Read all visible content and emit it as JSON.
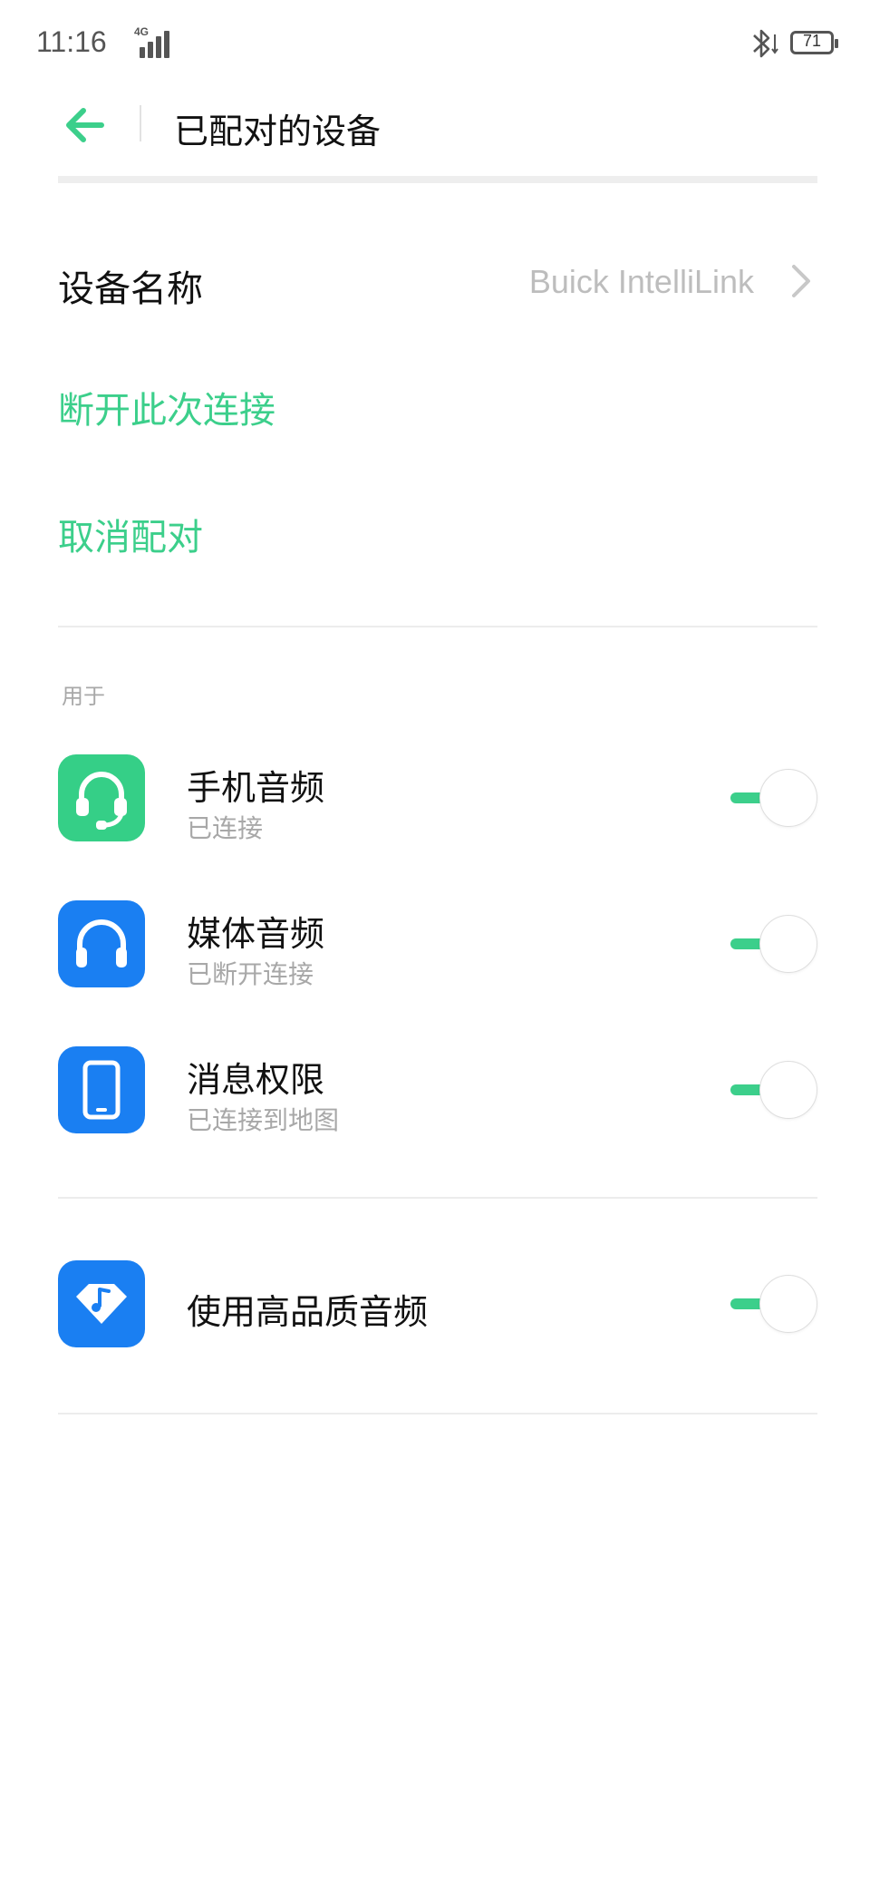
{
  "status_bar": {
    "time": "11:16",
    "network": "4G",
    "battery": "71"
  },
  "header": {
    "title": "已配对的设备",
    "back_icon": "back-arrow-icon"
  },
  "device": {
    "name_label": "设备名称",
    "name_value": "Buick IntelliLink",
    "chevron_icon": "chevron-right-icon"
  },
  "actions": {
    "disconnect": "断开此次连接",
    "unpair": "取消配对"
  },
  "section": {
    "label": "用于"
  },
  "items": [
    {
      "title": "手机音频",
      "subtitle": "已连接",
      "icon": "headset-icon",
      "icon_color": "#35cf87",
      "enabled": true
    },
    {
      "title": "媒体音频",
      "subtitle": "已断开连接",
      "icon": "headphones-icon",
      "icon_color": "#1a7ff2",
      "enabled": true
    },
    {
      "title": "消息权限",
      "subtitle": "已连接到地图",
      "icon": "phone-icon",
      "icon_color": "#1a7ff2",
      "enabled": true
    }
  ],
  "hq_audio": {
    "title": "使用高品质音频",
    "icon": "hq-audio-icon",
    "icon_color": "#1a7ff2",
    "enabled": true
  },
  "colors": {
    "accent": "#3ccf8b",
    "secondary_text": "#a8a8a8"
  }
}
